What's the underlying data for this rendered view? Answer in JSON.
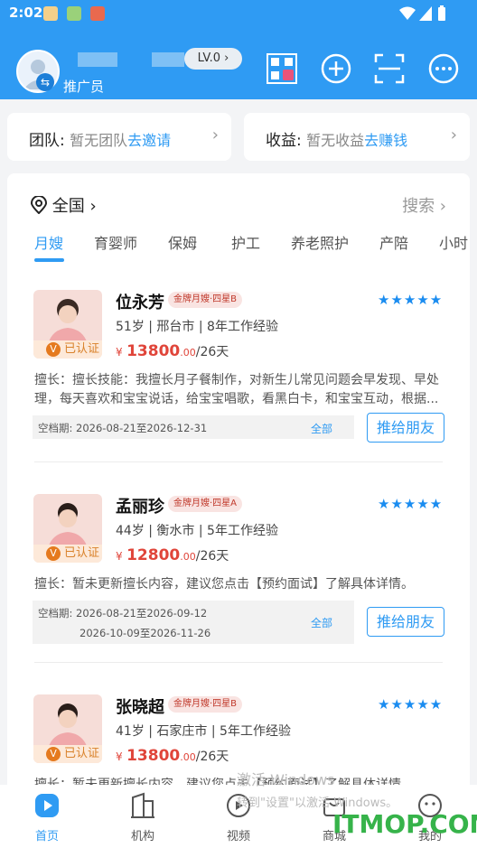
{
  "status_bar": {
    "time": "2:02"
  },
  "header": {
    "level_badge": "LV.0",
    "role": "推广员"
  },
  "team_card": {
    "label": "团队:",
    "empty_text": "暂无团队",
    "action": "去邀请"
  },
  "income_card": {
    "label": "收益:",
    "empty_text": "暂无收益",
    "action": "去赚钱"
  },
  "location": {
    "region": "全国",
    "search_label": "搜索"
  },
  "tabs": [
    "月嫂",
    "育婴师",
    "保姆",
    "护工",
    "养老照护",
    "产陪",
    "小时"
  ],
  "active_tab": "月嫂",
  "listings": [
    {
      "name": "位永芳",
      "level_tag": "金牌月嫂·四星B",
      "rating": "★★★★★",
      "meta": "51岁 | 邢台市 | 8年工作经验",
      "price_yen": "¥",
      "price_int": "13800",
      "price_dec": ".00",
      "price_unit": "/26天",
      "verified": "已认证",
      "skill": "擅长：擅长技能：我擅长月子餐制作，对新生儿常见问题会早发现、早处理，每天喜欢和宝宝说话，给宝宝唱歌，看黑白卡，和宝宝互动，根据...",
      "availability_label": "空档期:",
      "availability": [
        "2026-08-21至2026-12-31"
      ],
      "availability_all": "全部",
      "share_button": "推给朋友"
    },
    {
      "name": "孟丽珍",
      "level_tag": "金牌月嫂·四星A",
      "rating": "★★★★★",
      "meta": "44岁 | 衡水市 | 5年工作经验",
      "price_yen": "¥",
      "price_int": "12800",
      "price_dec": ".00",
      "price_unit": "/26天",
      "verified": "已认证",
      "skill": "擅长：暂未更新擅长内容，建议您点击【预约面试】了解具体详情。",
      "availability_label": "空档期:",
      "availability": [
        "2026-08-21至2026-09-12",
        "2026-10-09至2026-11-26"
      ],
      "availability_all": "全部",
      "share_button": "推给朋友"
    },
    {
      "name": "张晓超",
      "level_tag": "金牌月嫂·四星B",
      "rating": "★★★★★",
      "meta": "41岁 | 石家庄市 | 5年工作经验",
      "price_yen": "¥",
      "price_int": "13800",
      "price_dec": ".00",
      "price_unit": "/26天",
      "verified": "已认证",
      "skill": "擅长：暂未更新擅长内容，建议您点击【预约面试】了解具体详情。"
    }
  ],
  "bottom_nav": [
    "首页",
    "机构",
    "视频",
    "商城",
    "我的"
  ],
  "watermark": {
    "line1": "激活 Windows",
    "line2": "转到\"设置\"以激活 Windows。",
    "site": "ITMOP.COM"
  },
  "colors": {
    "primary": "#2f9bf3",
    "price": "#e0453a",
    "accent_green": "#36b34a"
  }
}
